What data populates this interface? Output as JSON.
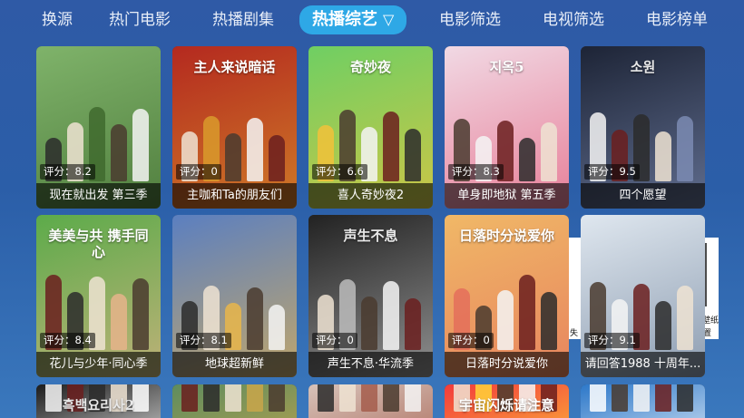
{
  "tabs": [
    {
      "label": "换源",
      "active": false
    },
    {
      "label": "热门电影",
      "active": false
    },
    {
      "label": "热播剧集",
      "active": false
    },
    {
      "label": "热播综艺",
      "active": true,
      "icon": "filter-icon"
    },
    {
      "label": "电影筛选",
      "active": false
    },
    {
      "label": "电视筛选",
      "active": false
    },
    {
      "label": "电影榜单",
      "active": false
    }
  ],
  "filter_glyph": "▽",
  "cards": [
    {
      "title": "现在就出发 第三季",
      "score": "评分：8.2",
      "bg": "#7fb36a",
      "accent": "#3f6a2e",
      "poster_text": ""
    },
    {
      "title": "主咖和Ta的朋友们",
      "score": "评分：0",
      "bg": "#b4291f",
      "accent": "#d99a2b",
      "poster_text": "主人来说暗话"
    },
    {
      "title": "喜人奇妙夜2",
      "score": "评分：6.6",
      "bg": "#6fcf63",
      "accent": "#f2c23a",
      "poster_text": "奇妙夜"
    },
    {
      "title": "单身即地狱 第五季",
      "score": "评分：8.3",
      "bg": "#f1d9e4",
      "accent": "#e35b7a",
      "poster_text": "지옥5"
    },
    {
      "title": "四个愿望",
      "score": "评分：9.5",
      "bg": "#1d2436",
      "accent": "#7b8bb3",
      "poster_text": "소원"
    },
    {
      "title": "花儿与少年·同心季",
      "score": "评分：8.4",
      "bg": "#5cab4a",
      "accent": "#e6b48b",
      "poster_text": "美美与共 携手同心"
    },
    {
      "title": "地球超新鲜",
      "score": "评分：8.1",
      "bg": "#5b7fc0",
      "accent": "#e9b64a",
      "poster_text": ""
    },
    {
      "title": "声生不息·华流季",
      "score": "评分：0",
      "bg": "#222222",
      "accent": "#bcbcbc",
      "poster_text": "声生不息"
    },
    {
      "title": "日落时分说爱你",
      "score": "评分：0",
      "bg": "#f0b867",
      "accent": "#e46f5a",
      "poster_text": "日落时分说爱你"
    },
    {
      "title": "请回答1988 十周年...",
      "score": "评分：9.1",
      "bg": "#dfe7ef",
      "accent": "#6c7f98",
      "poster_text": ""
    },
    {
      "title": "",
      "score": "",
      "bg": "#1c1c1c",
      "accent": "#ffffff",
      "poster_text": "흑백요리사2"
    },
    {
      "title": "",
      "score": "",
      "bg": "#5e8c5e",
      "accent": "#c9a64a",
      "poster_text": ""
    },
    {
      "title": "",
      "score": "",
      "bg": "#d7c2b9",
      "accent": "#a45d4c",
      "poster_text": ""
    },
    {
      "title": "",
      "score": "",
      "bg": "#f23b3b",
      "accent": "#ffd23a",
      "poster_text": "宇宙闪烁请注意"
    },
    {
      "title": "",
      "score": "",
      "bg": "#2d78c9",
      "accent": "#ffffff",
      "poster_text": ""
    }
  ],
  "overlay": {
    "left_text": "失",
    "right_top": "壁纸",
    "right_bottom": "重置"
  }
}
